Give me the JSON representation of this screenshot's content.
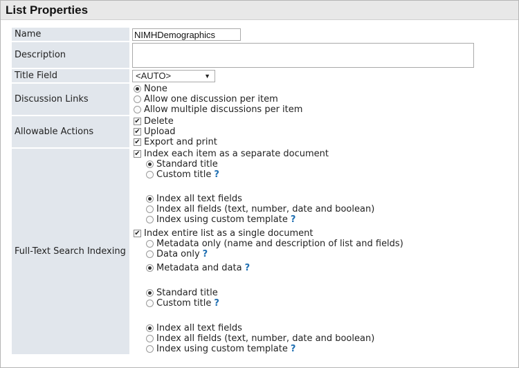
{
  "panel": {
    "title": "List Properties"
  },
  "fields": {
    "name": {
      "label": "Name",
      "value": "NIMHDemographics"
    },
    "description": {
      "label": "Description",
      "value": ""
    },
    "title_field": {
      "label": "Title Field",
      "value": "<AUTO>"
    },
    "discussion_links": {
      "label": "Discussion Links",
      "options": [
        "None",
        "Allow one discussion per item",
        "Allow multiple discussions per item"
      ],
      "selected": "None"
    },
    "allowable_actions": {
      "label": "Allowable Actions",
      "options": [
        "Delete",
        "Upload",
        "Export and print"
      ]
    },
    "fts": {
      "label": "Full-Text Search Indexing",
      "per_item": {
        "label": "Index each item as a separate document",
        "standard_title": "Standard title",
        "custom_title": "Custom title",
        "all_text": "Index all text fields",
        "all_fields": "Index all fields (text, number, date and boolean)",
        "custom_template": "Index using custom template"
      },
      "whole_list": {
        "label": "Index entire list as a single document",
        "metadata_only": "Metadata only (name and description of list and fields)",
        "data_only": "Data only",
        "metadata_and_data": "Metadata and data",
        "standard_title": "Standard title",
        "custom_title": "Custom title",
        "all_text": "Index all text fields",
        "all_fields": "Index all fields (text, number, date and boolean)",
        "custom_template": "Index using custom template"
      },
      "help": "?"
    }
  },
  "glyphs": {
    "dropdown_arrow": "▼",
    "check": "✔"
  }
}
